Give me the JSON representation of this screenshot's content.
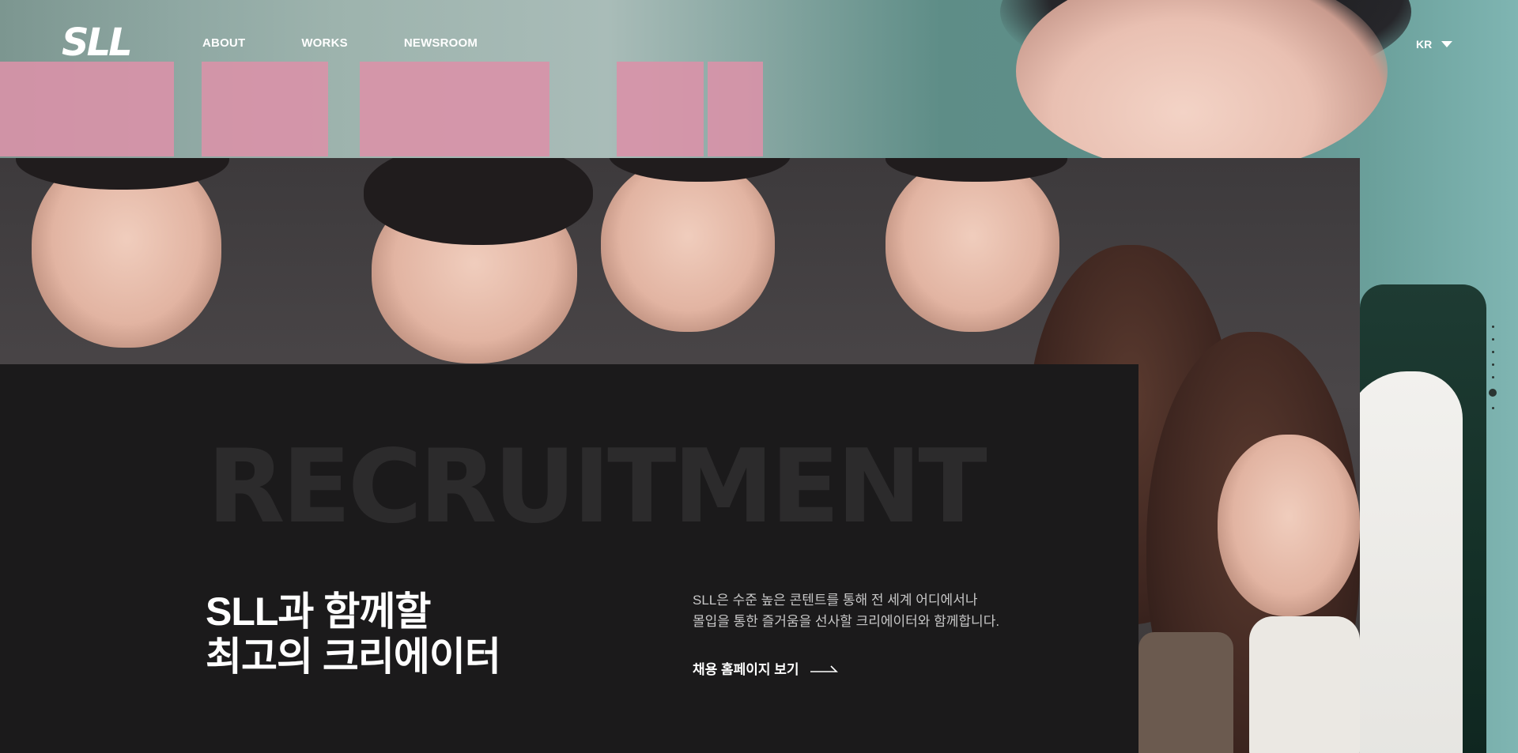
{
  "nav": {
    "logo": "SLL",
    "items": [
      {
        "label": "ABOUT"
      },
      {
        "label": "WORKS"
      },
      {
        "label": "NEWSROOM"
      }
    ],
    "language": "KR"
  },
  "section": {
    "big_word": "RECRUITMENT",
    "heading_line1": "SLL과 함께할",
    "heading_line2": "최고의 크리에이터",
    "desc_line1": "SLL은 수준 높은 콘텐트를 통해 전 세계 어디에서나",
    "desc_line2": "몰입을 통한 즐거움을 선사할 크리에이터와 함께합니다.",
    "cta_label": "채용 홈페이지 보기"
  },
  "pagination": {
    "total": 7,
    "active_index": 5
  },
  "colors": {
    "panel_bg": "#1b1a1b",
    "big_word": "#2c2b2c",
    "text_primary": "#ffffff",
    "text_secondary": "#c7c7c7"
  }
}
